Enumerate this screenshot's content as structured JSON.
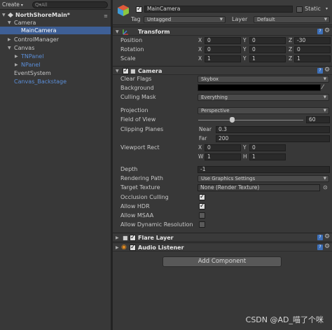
{
  "hierarchy": {
    "create_label": "Create",
    "search_placeholder": "Q▾All",
    "scene_name": "NorthShoreMain*",
    "items": [
      {
        "label": "Camera"
      },
      {
        "label": "MainCamera"
      },
      {
        "label": "ControlManager"
      },
      {
        "label": "Canvas"
      },
      {
        "label": "TNPanel"
      },
      {
        "label": "NPanel"
      },
      {
        "label": "EventSystem"
      },
      {
        "label": "Canvas_Backstage"
      }
    ]
  },
  "inspector": {
    "object_name": "MainCamera",
    "static_label": "Static",
    "tag_label": "Tag",
    "tag_value": "Untagged",
    "layer_label": "Layer",
    "layer_value": "Default",
    "transform": {
      "title": "Transform",
      "position_label": "Position",
      "rotation_label": "Rotation",
      "scale_label": "Scale",
      "position": {
        "x": "0",
        "y": "0",
        "z": "-30"
      },
      "rotation": {
        "x": "0",
        "y": "0",
        "z": "0"
      },
      "scale": {
        "x": "1",
        "y": "1",
        "z": "1"
      },
      "axis_x": "X",
      "axis_y": "Y",
      "axis_z": "Z"
    },
    "camera": {
      "title": "Camera",
      "clear_flags_label": "Clear Flags",
      "clear_flags_value": "Skybox",
      "background_label": "Background",
      "background_color": "#000000",
      "culling_mask_label": "Culling Mask",
      "culling_mask_value": "Everything",
      "projection_label": "Projection",
      "projection_value": "Perspective",
      "fov_label": "Field of View",
      "fov_value": "60",
      "clipping_label": "Clipping Planes",
      "near_label": "Near",
      "near_value": "0.3",
      "far_label": "Far",
      "far_value": "200",
      "viewport_label": "Viewport Rect",
      "viewport": {
        "x": "0",
        "y": "0",
        "w": "1",
        "h": "1"
      },
      "viewport_axis_x": "X",
      "viewport_axis_y": "Y",
      "viewport_axis_w": "W",
      "viewport_axis_h": "H",
      "depth_label": "Depth",
      "depth_value": "-1",
      "rendering_path_label": "Rendering Path",
      "rendering_path_value": "Use Graphics Settings",
      "target_texture_label": "Target Texture",
      "target_texture_value": "None (Render Texture)",
      "occlusion_label": "Occlusion Culling",
      "hdr_label": "Allow HDR",
      "msaa_label": "Allow MSAA",
      "dynres_label": "Allow Dynamic Resolution"
    },
    "flare_layer_title": "Flare Layer",
    "audio_listener_title": "Audio Listener",
    "add_component_label": "Add Component"
  },
  "watermark": "CSDN @AD_喵了个咪"
}
